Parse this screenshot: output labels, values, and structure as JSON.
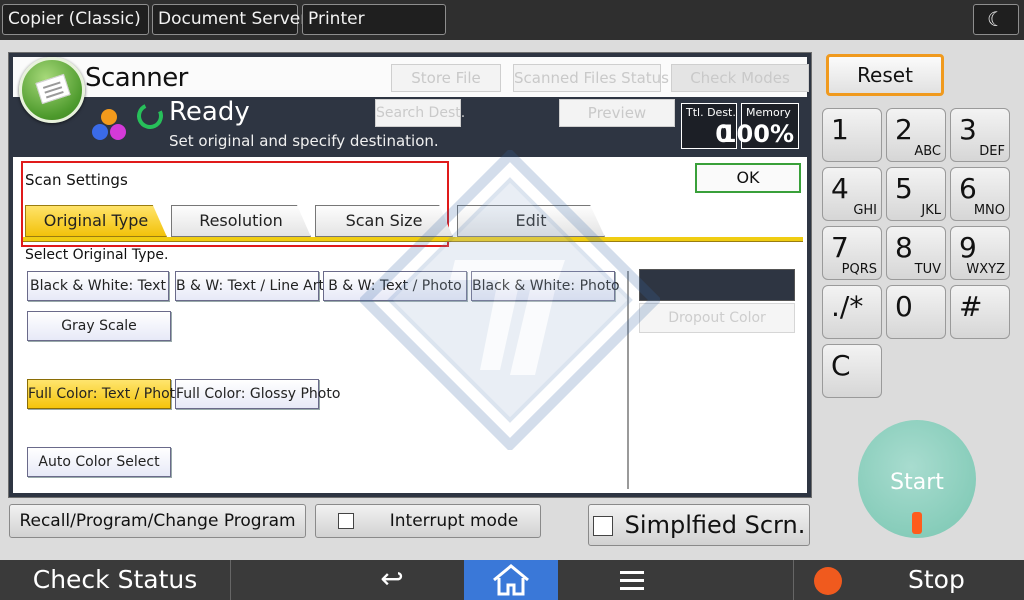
{
  "top_tabs": [
    "Copier (Classic)",
    "Document Server",
    "Printer"
  ],
  "top_right_icon": "moon-icon",
  "scanner": {
    "title": "Scanner",
    "buttons": {
      "store_file": "Store File",
      "scanned_status": "Scanned Files Status",
      "check_modes": "Check Modes",
      "search_dest": "Search Dest.",
      "preview": "Preview"
    },
    "status": "Ready",
    "status_sub": "Set original and specify destination.",
    "counters": {
      "ttl_dest_label": "Ttl. Dest.",
      "ttl_dest_value": "0",
      "memory_label": "Memory",
      "memory_value": "100%"
    }
  },
  "settings": {
    "label": "Scan Settings",
    "ok": "OK",
    "tabs": [
      "Original Type",
      "Resolution",
      "Scan Size",
      "Edit"
    ],
    "active_tab": "Original Type",
    "select_label": "Select Original Type.",
    "options": {
      "bw_text": "Black & White: Text",
      "bw_line": "B & W: Text / Line Art",
      "bw_photo": "B & W: Text / Photo",
      "bw_photo2": "Black & White: Photo",
      "gray": "Gray Scale",
      "fc_text_photo": "Full Color: Text / Photo",
      "fc_glossy": "Full Color: Glossy Photo",
      "auto": "Auto Color Select"
    },
    "selected_option": "Full Color: Text / Photo",
    "dropout": "Dropout Color"
  },
  "bottom_buttons": {
    "recall": "Recall/Program/Change Program",
    "interrupt": "Interrupt mode",
    "simplified": "Simplfied Scrn."
  },
  "keypad": {
    "reset": "Reset",
    "keys": [
      {
        "digit": "1",
        "sub": ""
      },
      {
        "digit": "2",
        "sub": "ABC"
      },
      {
        "digit": "3",
        "sub": "DEF"
      },
      {
        "digit": "4",
        "sub": "GHI"
      },
      {
        "digit": "5",
        "sub": "JKL"
      },
      {
        "digit": "6",
        "sub": "MNO"
      },
      {
        "digit": "7",
        "sub": "PQRS"
      },
      {
        "digit": "8",
        "sub": "TUV"
      },
      {
        "digit": "9",
        "sub": "WXYZ"
      },
      {
        "digit": "./*",
        "sub": ""
      },
      {
        "digit": "0",
        "sub": ""
      },
      {
        "digit": "#",
        "sub": ""
      },
      {
        "digit": "C",
        "sub": ""
      }
    ],
    "start": "Start"
  },
  "system_bar": {
    "check_status": "Check Status",
    "stop": "Stop"
  },
  "colors": {
    "active_yellow": "#f2c20a",
    "ready_green": "#27c05a",
    "reset_orange": "#f09a1e",
    "home_blue": "#3a78d8",
    "stop_orange": "#f05a1e",
    "highlight_red": "#e01a1a"
  }
}
